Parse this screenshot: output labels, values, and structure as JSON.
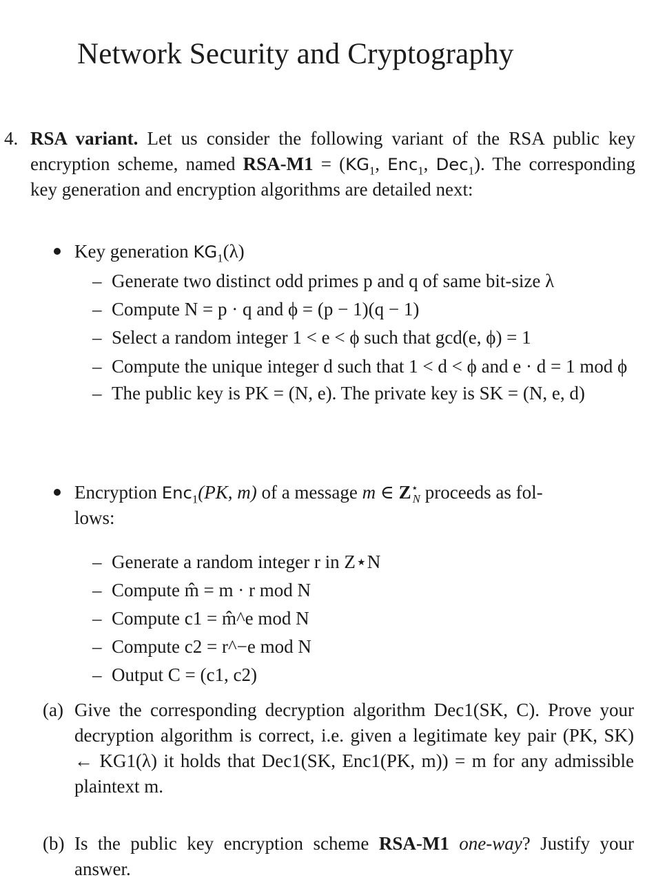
{
  "page_title": "Network Security and Cryptography",
  "problem": {
    "number": "4.",
    "heading": "RSA variant.",
    "intro_1": " Let us consider the following variant of the RSA public key encryption scheme, named ",
    "scheme_name": "RSA-M1",
    "scheme_tuple_eq": " = (",
    "kg": "KG",
    "enc": "Enc",
    "dec": "Dec",
    "sub1": "1",
    "comma": ", ",
    "tuple_close": "). ",
    "intro_2": " The corresponding key generation and encryption algorithms are detailed next:"
  },
  "keygen": {
    "bullet_label": "Key generation ",
    "bullet_math": "KG",
    "bullet_sub": "1",
    "bullet_arg": "(λ)",
    "steps": [
      "Generate two distinct odd primes p and q of same bit-size λ",
      "Compute N = p · q and ϕ = (p − 1)(q − 1)",
      "Select a random integer 1 < e < ϕ such that gcd(e, ϕ) = 1",
      "Compute the unique integer d such that 1 < d < ϕ and e · d = 1 mod ϕ",
      "The public key is PK = (N, e). The private key is SK = (N, e, d)"
    ]
  },
  "encryption": {
    "bullet_label": "Encryption ",
    "bullet_math": "Enc",
    "bullet_sub": "1",
    "bullet_args": "(PK, m)",
    "bullet_rest_1": " of a message ",
    "bullet_m": "m",
    "bullet_in": " ∈ ",
    "bullet_Z": "Z",
    "bullet_star": "⋆",
    "bullet_N": "N",
    "bullet_rest_2": " proceeds as fol-",
    "bullet_rest_3": "lows:",
    "steps": [
      "Generate a random integer r in Z⋆N",
      "Compute m̂ = m · r mod N",
      "Compute c1 = m̂^e mod N",
      "Compute c2 = r^−e mod N",
      "Output C = (c1, c2)"
    ]
  },
  "questions": [
    {
      "label": "(a)",
      "text": "Give the corresponding decryption algorithm Dec1(SK, C). Prove your decryption algorithm is correct, i.e. given a legitimate key pair (PK, SK) ← KG1(λ) it holds that Dec1(SK, Enc1(PK, m)) = m for any admissible plaintext m."
    },
    {
      "label": "(b)",
      "text_1": "Is the public key encryption scheme ",
      "scheme_name": "RSA-M1",
      "text_2": " ",
      "emph": "one-way",
      "text_3": "? Justify your answer."
    }
  ]
}
